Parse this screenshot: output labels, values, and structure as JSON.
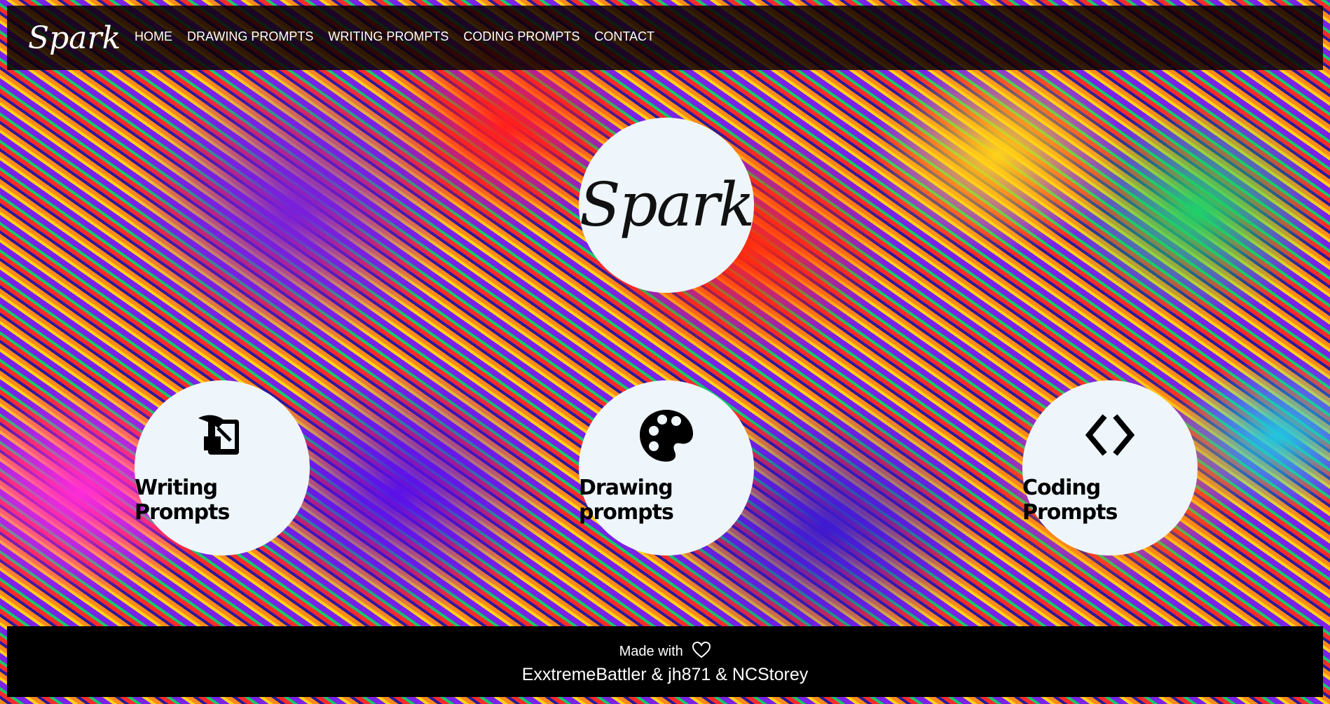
{
  "nav": {
    "logo": "Spark",
    "links": [
      "HOME",
      "DRAWING PROMPTS",
      "WRITING PROMPTS",
      "CODING PROMPTS",
      "CONTACT"
    ]
  },
  "hero": {
    "logo": "Spark"
  },
  "cards": [
    {
      "label": "Writing Prompts",
      "icon": "writing-icon"
    },
    {
      "label": "Drawing prompts",
      "icon": "palette-icon"
    },
    {
      "label": "Coding Prompts",
      "icon": "code-icon"
    }
  ],
  "footer": {
    "made_with": "Made with",
    "heart_icon": "heart-icon",
    "authors": "ExxtremeBattler & jh871 & NCStorey"
  },
  "colors": {
    "circle_bg": "#eef6fc",
    "footer_bg": "#000000",
    "nav_bg": "#0a0000"
  }
}
